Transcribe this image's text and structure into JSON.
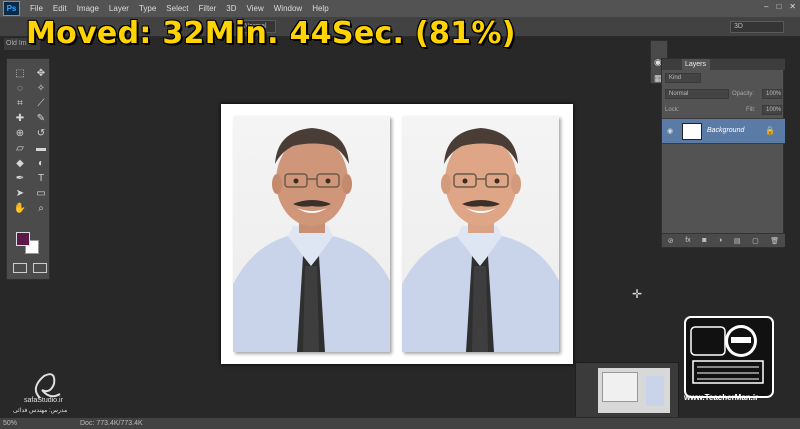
{
  "app": {
    "logo": "Ps"
  },
  "menu": [
    "File",
    "Edit",
    "Image",
    "Layer",
    "Type",
    "Select",
    "Filter",
    "3D",
    "View",
    "Window",
    "Help"
  ],
  "window_controls": [
    "–",
    "□",
    "✕"
  ],
  "overlay": {
    "title": "Moved: 32Min. 44Sec. (81%)",
    "color": "#ffd400"
  },
  "options_bar": {
    "style_value": "Normal"
  },
  "document_tab": {
    "label": "Old Im"
  },
  "workspace": {
    "value": "3D"
  },
  "tools": {
    "icons": [
      "marquee-icon",
      "move-icon",
      "lasso-icon",
      "magic-wand-icon",
      "crop-icon",
      "eyedropper-icon",
      "healing-icon",
      "brush-icon",
      "clone-stamp-icon",
      "history-brush-icon",
      "eraser-icon",
      "gradient-icon",
      "blur-icon",
      "dodge-icon",
      "pen-icon",
      "type-icon",
      "path-select-icon",
      "shape-icon",
      "hand-icon",
      "zoom-icon"
    ],
    "glyphs": [
      "⬚",
      "✥",
      "◌",
      "✧",
      "⌗",
      "⟋",
      "✚",
      "✎",
      "⊕",
      "↺",
      "▱",
      "▬",
      "◆",
      "◐",
      "✒",
      "T",
      "➤",
      "▭",
      "✋",
      "⌕"
    ],
    "foreground_color": "#5b1a49",
    "background_color": "#ffffff"
  },
  "layers": {
    "tab_label": "Layers",
    "kind_label": "Kind",
    "blend_mode": "Normal",
    "opacity_label": "Opacity:",
    "opacity_value": "100%",
    "lock_label": "Lock:",
    "fill_label": "Fill:",
    "fill_value": "100%",
    "items": [
      {
        "name": "Background",
        "locked": true,
        "visible": true
      }
    ],
    "footer_icons": [
      "link-icon",
      "fx-icon",
      "mask-icon",
      "adjustment-icon",
      "folder-icon",
      "new-layer-icon",
      "trash-icon"
    ],
    "footer_glyphs": [
      "⊘",
      "fx",
      "◙",
      "◑",
      "▤",
      "▢",
      "🗑"
    ]
  },
  "canvas": {
    "background": "#ffffff"
  },
  "status_bar": {
    "zoom": "50%",
    "doc": "Doc: 773.4K/773.4K"
  },
  "watermarks": {
    "teacher_url": "www.TeacherMan.ir",
    "safa_name": "safaStudio.ir",
    "safa_sub": "مدرس: مهندس فدائی"
  }
}
